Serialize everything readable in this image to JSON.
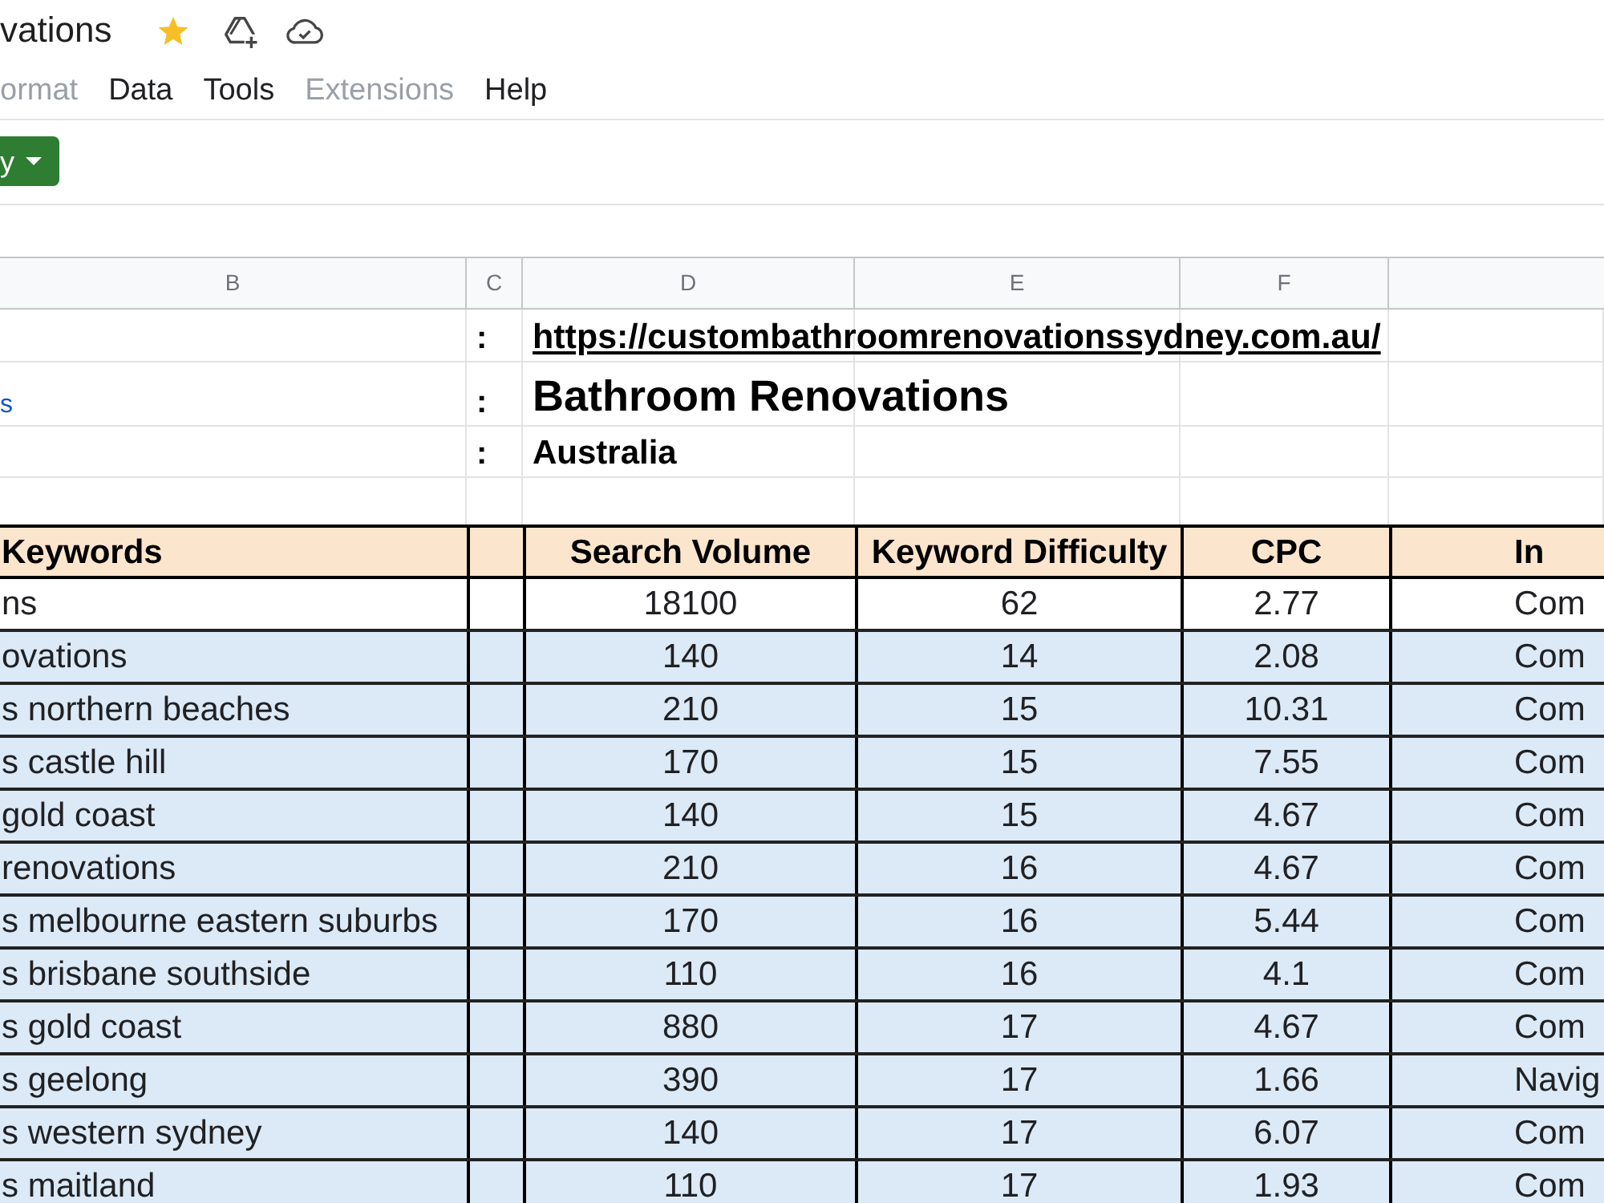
{
  "document": {
    "title": "vations",
    "starred": true
  },
  "menu": [
    {
      "label": "ormat",
      "disabled": true
    },
    {
      "label": "Data",
      "disabled": false
    },
    {
      "label": "Tools",
      "disabled": false
    },
    {
      "label": "Extensions",
      "disabled": true
    },
    {
      "label": "Help",
      "disabled": false
    }
  ],
  "toolbar": {
    "button": "y"
  },
  "column_headers": [
    "B",
    "C",
    "D",
    "E",
    "F"
  ],
  "sheet_info": [
    {
      "kind": "link",
      "separator": ":",
      "value": "https://custombathroomrenovationssydney.com.au/"
    },
    {
      "kind": "heading",
      "label": "s",
      "separator": ":",
      "value": "Bathroom Renovations"
    },
    {
      "kind": "text",
      "separator": ":",
      "value": "Australia"
    }
  ],
  "table": {
    "columns": [
      "Keywords",
      "Search Volume",
      "Keyword Difficulty",
      "CPC",
      "In"
    ],
    "rows": [
      {
        "shaded": false,
        "cells": [
          "ns",
          "18100",
          "62",
          "2.77",
          "Com"
        ]
      },
      {
        "shaded": true,
        "cells": [
          "ovations",
          "140",
          "14",
          "2.08",
          "Com"
        ]
      },
      {
        "shaded": true,
        "cells": [
          "s northern beaches",
          "210",
          "15",
          "10.31",
          "Com"
        ]
      },
      {
        "shaded": true,
        "cells": [
          "s castle hill",
          "170",
          "15",
          "7.55",
          "Com"
        ]
      },
      {
        "shaded": true,
        "cells": [
          "gold coast",
          "140",
          "15",
          "4.67",
          "Com"
        ]
      },
      {
        "shaded": true,
        "cells": [
          "renovations",
          "210",
          "16",
          "4.67",
          "Com"
        ]
      },
      {
        "shaded": true,
        "cells": [
          "s melbourne eastern suburbs",
          "170",
          "16",
          "5.44",
          "Com"
        ]
      },
      {
        "shaded": true,
        "cells": [
          "s brisbane southside",
          "110",
          "16",
          "4.1",
          "Com"
        ]
      },
      {
        "shaded": true,
        "cells": [
          "s gold coast",
          "880",
          "17",
          "4.67",
          "Com"
        ]
      },
      {
        "shaded": true,
        "cells": [
          "s geelong",
          "390",
          "17",
          "1.66",
          "Navig"
        ]
      },
      {
        "shaded": true,
        "cells": [
          "s western sydney",
          "140",
          "17",
          "6.07",
          "Com"
        ]
      },
      {
        "shaded": true,
        "cells": [
          "s maitland",
          "110",
          "17",
          "1.93",
          "Com"
        ]
      }
    ]
  }
}
